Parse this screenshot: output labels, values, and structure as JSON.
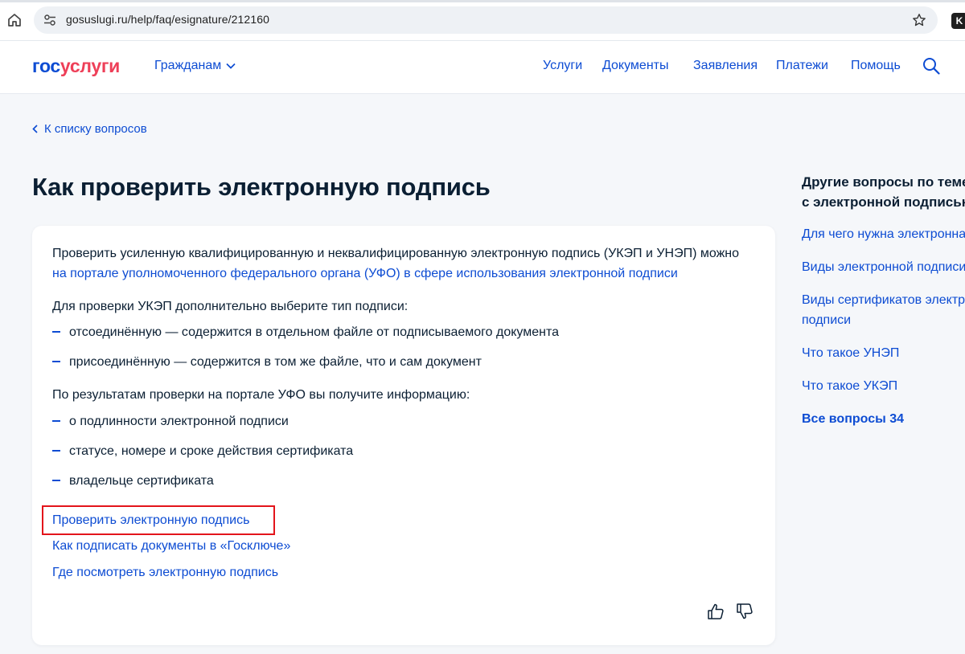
{
  "browser": {
    "url": "gosuslugi.ru/help/faq/esignature/212160",
    "extension_label": "K"
  },
  "header": {
    "logo_part1": "гос",
    "logo_part2": "услуги",
    "citizens_label": "Гражданам",
    "nav": [
      "Услуги",
      "Документы",
      "Заявления",
      "Платежи",
      "Помощь"
    ]
  },
  "page": {
    "back_link": "К списку вопросов",
    "title": "Как проверить электронную подпись"
  },
  "article": {
    "intro": "Проверить усиленную квалифицированную и неквалифицированную электронную подпись (УКЭП и УНЭП) можно",
    "intro_link": "на портале уполномоченного федерального органа (УФО) в сфере использования электронной подписи",
    "ukep_intro": "Для проверки УКЭП дополнительно выберите тип подписи:",
    "ukep_types": [
      "отсоединённую — содержится в отдельном файле от подписываемого документа",
      "присоединённую — содержится в том же файле, что и сам документ"
    ],
    "results_intro": "По результатам проверки на портале УФО вы получите информацию:",
    "results": [
      "о подлинности электронной подписи",
      "статусе, номере и сроке действия сертификата",
      "владельце сертификата"
    ],
    "links": [
      "Проверить электронную подпись",
      "Как подписать документы в «Госключе»",
      "Где посмотреть электронную подпись"
    ]
  },
  "sidebar": {
    "title_line1": "Другие вопросы по теме",
    "title_line2": "с электронной подписью",
    "links": [
      "Для чего нужна электронная подпись",
      "Виды электронной подписи",
      "Виды сертификатов электронной",
      "подписи",
      "Что такое УНЭП",
      "Что такое УКЭП"
    ],
    "all_questions": "Все вопросы 34"
  },
  "colors": {
    "brand_blue": "#0d4cd3",
    "brand_red": "#ee3f58",
    "highlight": "#e3141b",
    "text": "#0b1f33",
    "background": "#f5f7fa"
  }
}
